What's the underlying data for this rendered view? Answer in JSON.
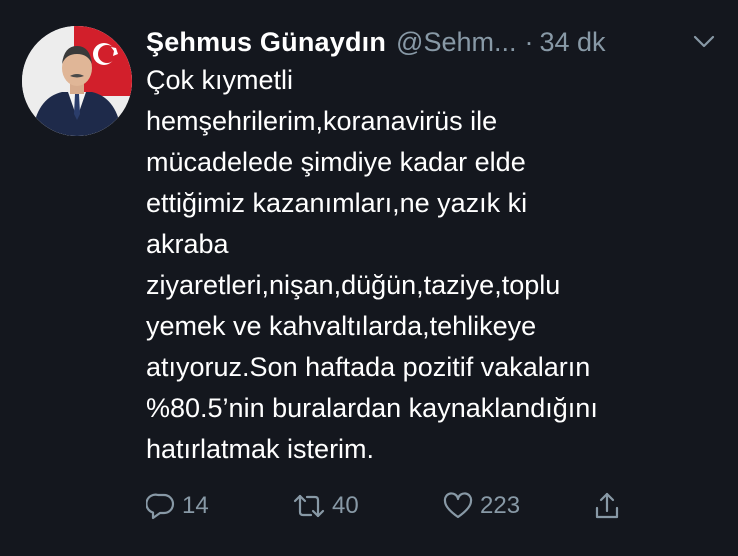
{
  "tweet": {
    "author": {
      "display_name": "Şehmus Günaydın",
      "handle": "@Sehm...",
      "avatar_icon": "profile-photo"
    },
    "separator": "·",
    "timestamp": "34 dk",
    "menu_icon": "chevron-down-icon",
    "text": "Çok kıymetli\nhemşehrilerim,koranavirüs ile\nmücadelede şimdiye kadar elde\nettiğimiz kazanımları,ne yazık ki\nakraba\nziyaretleri,nişan,düğün,taziye,toplu\nyemek ve kahvaltılarda,tehlikeye\natıyoruz.Son haftada pozitif vakaların\n%80.5’nin buralardan kaynaklandığını\nhatırlatmak isterim."
  },
  "actions": {
    "reply": {
      "icon": "reply-icon",
      "count": "14"
    },
    "retweet": {
      "icon": "retweet-icon",
      "count": "40"
    },
    "like": {
      "icon": "heart-icon",
      "count": "223"
    },
    "share": {
      "icon": "share-icon"
    }
  },
  "colors": {
    "background": "#14171e",
    "primary_text": "#ffffff",
    "secondary_text": "#8899a6"
  }
}
